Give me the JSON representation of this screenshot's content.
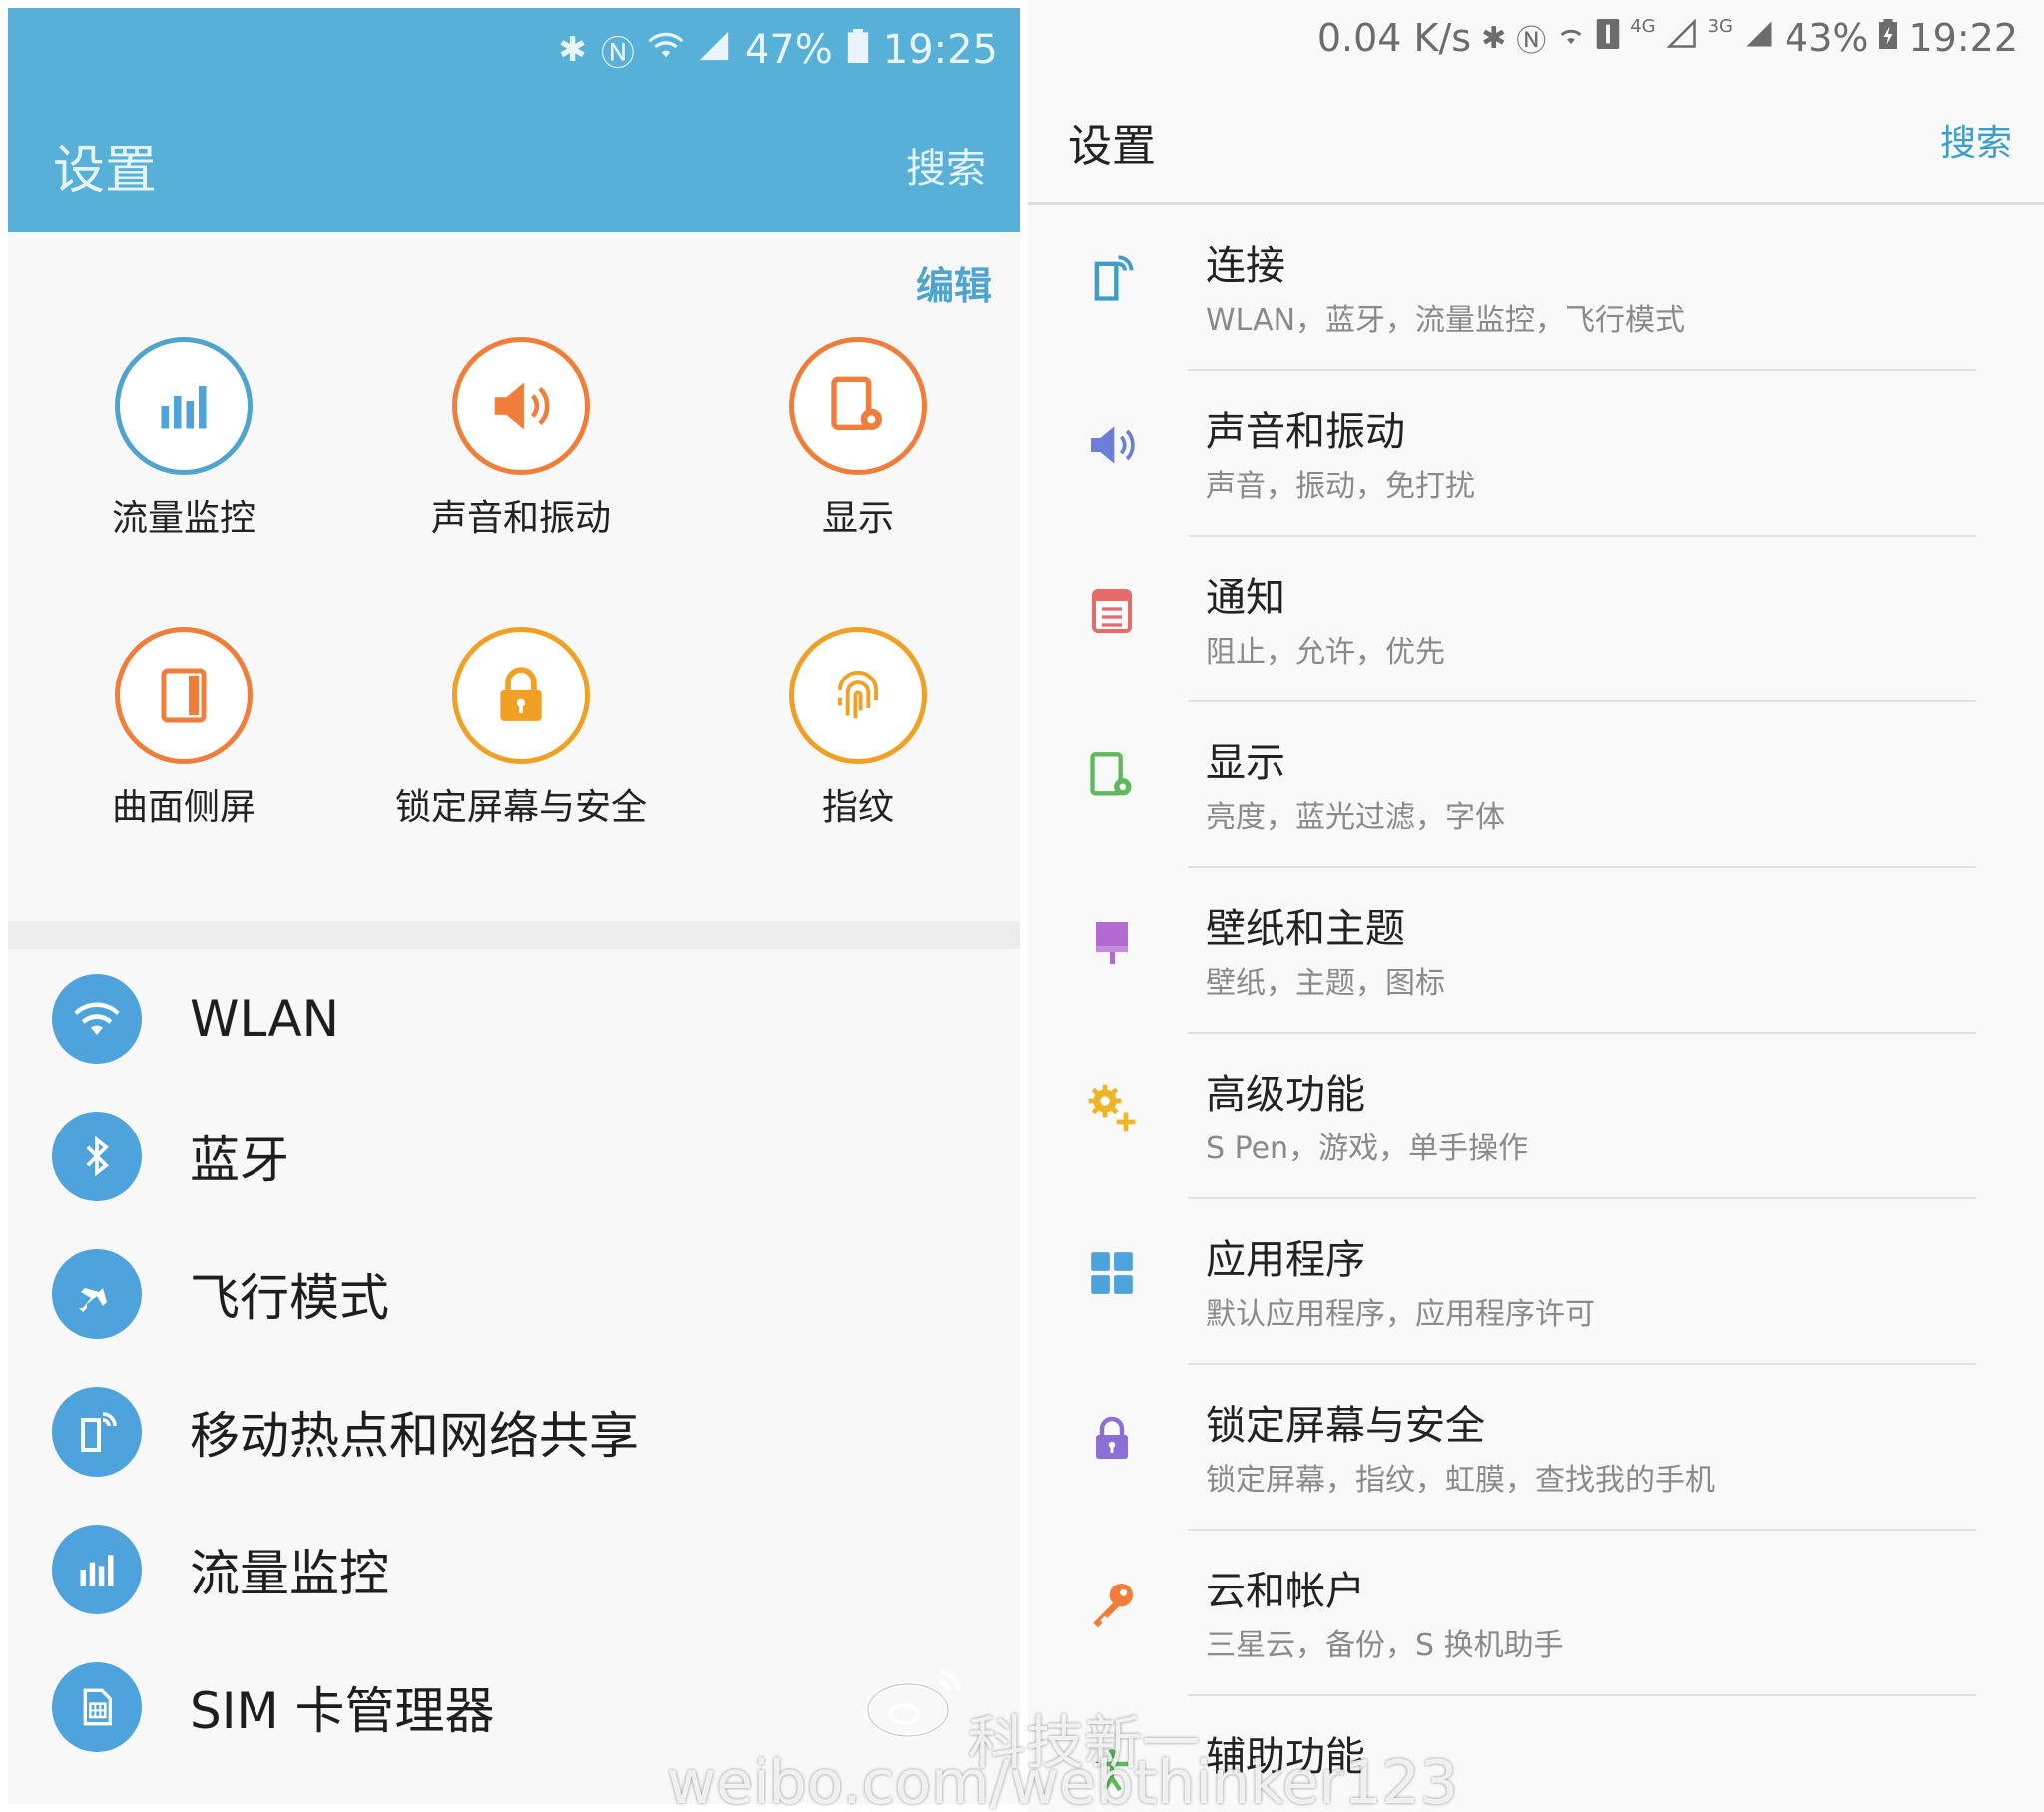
{
  "left": {
    "status": {
      "percent": "47%",
      "time": "19:25"
    },
    "title": "设置",
    "search_label": "搜索",
    "edit_label": "编辑",
    "quick_settings": [
      {
        "label": "流量监控",
        "icon": "data-usage-icon"
      },
      {
        "label": "声音和振动",
        "icon": "speaker-icon"
      },
      {
        "label": "显示",
        "icon": "display-icon"
      },
      {
        "label": "曲面侧屏",
        "icon": "edge-screen-icon"
      },
      {
        "label": "锁定屏幕与安全",
        "icon": "lock-icon"
      },
      {
        "label": "指纹",
        "icon": "fingerprint-icon"
      }
    ],
    "list": [
      {
        "label": "WLAN",
        "icon": "wifi-icon"
      },
      {
        "label": "蓝牙",
        "icon": "bluetooth-icon"
      },
      {
        "label": "飞行模式",
        "icon": "airplane-icon"
      },
      {
        "label": "移动热点和网络共享",
        "icon": "hotspot-icon"
      },
      {
        "label": "流量监控",
        "icon": "data-usage-icon"
      },
      {
        "label": "SIM 卡管理器",
        "icon": "sim-card-icon"
      }
    ]
  },
  "right": {
    "status": {
      "speed": "0.04 K/s",
      "net1": "4G",
      "net2": "3G",
      "percent": "43%",
      "time": "19:22"
    },
    "title": "设置",
    "search_label": "搜索",
    "list": [
      {
        "title": "连接",
        "subtitle": "WLAN，蓝牙，流量监控，飞行模式",
        "icon": "connections-icon"
      },
      {
        "title": "声音和振动",
        "subtitle": "声音，振动，免打扰",
        "icon": "speaker-icon"
      },
      {
        "title": "通知",
        "subtitle": "阻止，允许，优先",
        "icon": "notifications-icon"
      },
      {
        "title": "显示",
        "subtitle": "亮度，蓝光过滤，字体",
        "icon": "display-icon"
      },
      {
        "title": "壁纸和主题",
        "subtitle": "壁纸，主题，图标",
        "icon": "wallpaper-brush-icon"
      },
      {
        "title": "高级功能",
        "subtitle": "S Pen，游戏，单手操作",
        "icon": "advanced-gear-icon"
      },
      {
        "title": "应用程序",
        "subtitle": "默认应用程序，应用程序许可",
        "icon": "apps-grid-icon"
      },
      {
        "title": "锁定屏幕与安全",
        "subtitle": "锁定屏幕，指纹，虹膜，查找我的手机",
        "icon": "lock-icon"
      },
      {
        "title": "云和帐户",
        "subtitle": "三星云，备份，S 换机助手",
        "icon": "key-icon"
      },
      {
        "title": "辅助功能",
        "subtitle": "",
        "icon": "accessibility-icon"
      }
    ]
  },
  "watermark": {
    "name": "科技新一",
    "url": "weibo.com/webthinker123"
  },
  "colors": {
    "left_header": "#57b0d8",
    "accent_orange": "#f07e3a",
    "accent_blue": "#4ea3dc",
    "right_search": "#3d9fc9"
  }
}
